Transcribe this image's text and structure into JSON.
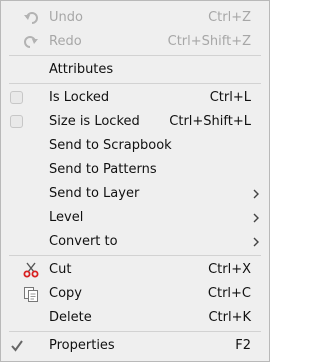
{
  "menu": {
    "undo": {
      "label": "Undo",
      "shortcut": "Ctrl+Z",
      "icon": "undo-icon"
    },
    "redo": {
      "label": "Redo",
      "shortcut": "Ctrl+Shift+Z",
      "icon": "redo-icon"
    },
    "attributes": {
      "label": "Attributes"
    },
    "is_locked": {
      "label": "Is Locked",
      "shortcut": "Ctrl+L",
      "checked": false
    },
    "size_is_locked": {
      "label": "Size is Locked",
      "shortcut": "Ctrl+Shift+L",
      "checked": false
    },
    "send_to_scrapbook": {
      "label": "Send to Scrapbook"
    },
    "send_to_patterns": {
      "label": "Send to Patterns"
    },
    "send_to_layer": {
      "label": "Send to Layer"
    },
    "level": {
      "label": "Level"
    },
    "convert_to": {
      "label": "Convert to"
    },
    "cut": {
      "label": "Cut",
      "shortcut": "Ctrl+X",
      "icon": "scissors-icon"
    },
    "copy": {
      "label": "Copy",
      "shortcut": "Ctrl+C",
      "icon": "copy-icon"
    },
    "delete": {
      "label": "Delete",
      "shortcut": "Ctrl+K"
    },
    "properties": {
      "label": "Properties",
      "shortcut": "F2",
      "checked": true
    }
  },
  "colors": {
    "background": "#efefef",
    "text": "#111111",
    "disabled_text": "#a7a7a7",
    "icon_red": "#d81f1f"
  }
}
